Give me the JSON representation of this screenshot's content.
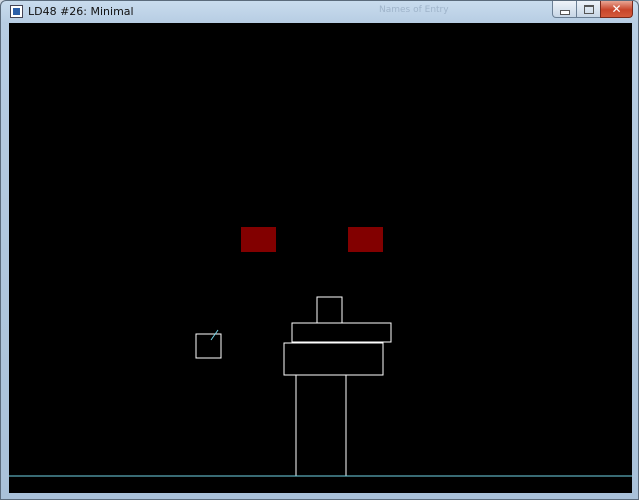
{
  "window": {
    "title": "LD48 #26: Minimal",
    "ghost_title": "Names of Entry",
    "buttons": {
      "minimize_icon": "minimize-icon",
      "maximize_icon": "maximize-icon",
      "close_icon": "close-icon",
      "close_glyph": "✕"
    }
  },
  "game": {
    "background_color": "#000000",
    "eye_color": "#820000",
    "outline_color": "#ffffff",
    "ground_color": "#6fd3e6"
  }
}
